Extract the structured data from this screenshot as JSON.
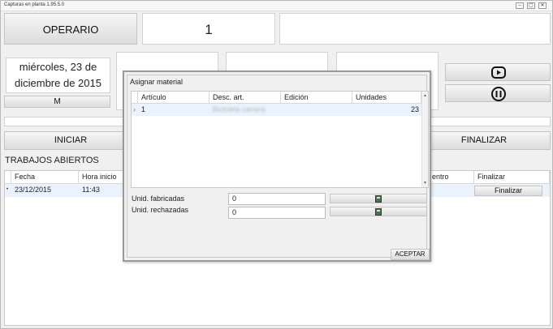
{
  "window": {
    "title": "Capturas en planta 1.95.5.0",
    "controls": [
      "–",
      "▢",
      "✕"
    ]
  },
  "header": {
    "operario_label": "OPERARIO",
    "operario_number": "1"
  },
  "date": {
    "line1": "miércoles, 23 de",
    "line2": "diciembre de 2015"
  },
  "m_button": "M",
  "actions": {
    "iniciar": "INICIAR",
    "finalizar": "FINALIZAR"
  },
  "trabajos": {
    "title": "TRABAJOS ABIERTOS",
    "columns": [
      "Fecha",
      "Hora inicio",
      "entro",
      "Finalizar"
    ],
    "rows": [
      {
        "marker": "•",
        "fecha": "23/12/2015",
        "hora": "11:43",
        "button": "Finalizar"
      }
    ]
  },
  "modal": {
    "title": "Asignar material",
    "columns": [
      "Artículo",
      "Desc. art.",
      "Edición",
      "Unidades"
    ],
    "rows": [
      {
        "marker": "›",
        "articulo": "1",
        "desc": "Bicicleta carrera",
        "edicion": "",
        "unidades": "23"
      }
    ],
    "fields": [
      {
        "label": "Unid. fabricadas",
        "value": "0"
      },
      {
        "label": "Unid. rechazadas",
        "value": "0"
      }
    ],
    "accept": "ACEPTAR"
  },
  "colors": {
    "row_selected": "#e9f2fd",
    "window_bg": "#f0f0f0"
  }
}
